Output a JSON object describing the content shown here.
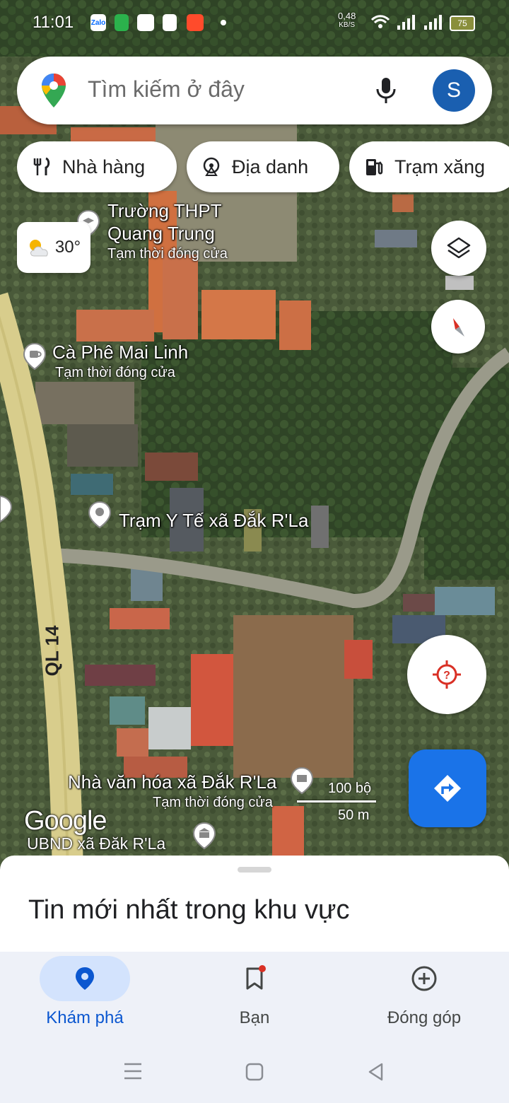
{
  "status_bar": {
    "time": "11:01",
    "app_icons": [
      "Zalo",
      "Messages",
      "4G",
      "Shopee",
      "Opera"
    ],
    "speed_value": "0,48",
    "speed_unit": "KB/S",
    "battery": "75"
  },
  "search": {
    "placeholder": "Tìm kiếm ở đây",
    "avatar_letter": "S"
  },
  "chips": [
    {
      "label": "Nhà hàng",
      "icon": "restaurant-icon"
    },
    {
      "label": "Địa danh",
      "icon": "landmark-icon"
    },
    {
      "label": "Trạm xăng",
      "icon": "gas-station-icon"
    }
  ],
  "weather": {
    "temp": "30°",
    "icon": "partly-cloudy-icon"
  },
  "map_labels": {
    "school_line1": "Trường THPT",
    "school_line2": "Quang Trung",
    "school_status": "Tạm thời đóng cửa",
    "cafe": "Cà Phê Mai Linh",
    "cafe_status": "Tạm thời đóng cửa",
    "clinic": "Trạm Y Tế xã Đắk R'La",
    "culture_house": "Nhà văn hóa xã Đắk R'La",
    "culture_status": "Tạm thời đóng cửa",
    "committee": "UBND xã Đăk R'La",
    "road": "QL 14"
  },
  "scale": {
    "imperial": "100 bộ",
    "metric": "50 m"
  },
  "google_logo": "Google",
  "sheet": {
    "title": "Tin mới nhất trong khu vực"
  },
  "bottom_nav": [
    {
      "label": "Khám phá",
      "icon": "location-pin-icon",
      "active": true
    },
    {
      "label": "Bạn",
      "icon": "bookmark-icon",
      "active": false,
      "badge": true
    },
    {
      "label": "Đóng góp",
      "icon": "add-circle-icon",
      "active": false
    }
  ],
  "colors": {
    "accent": "#1a73e8",
    "avatar": "#1a5fb0",
    "badge": "#d93025"
  }
}
